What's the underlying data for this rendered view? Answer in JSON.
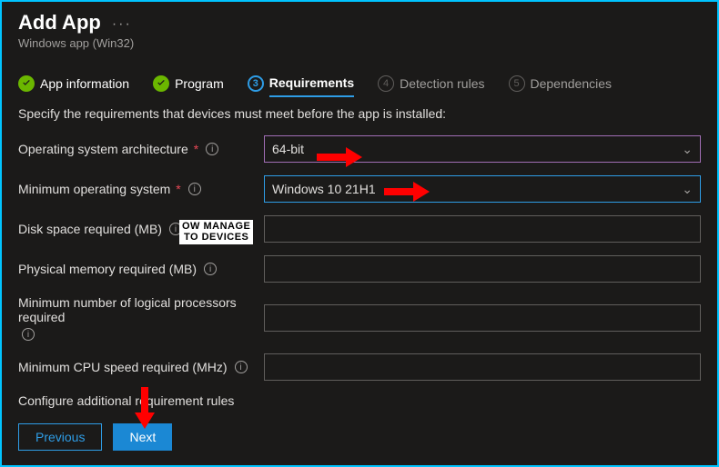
{
  "header": {
    "title": "Add App",
    "ellipsis": "···",
    "subtitle": "Windows app (Win32)"
  },
  "tabs": {
    "t1": "App information",
    "t2": "Program",
    "t3": "Requirements",
    "t4": "Detection rules",
    "t5": "Dependencies",
    "n3": "3",
    "n4": "4",
    "n5": "5"
  },
  "instruction": "Specify the requirements that devices must meet before the app is installed:",
  "fields": {
    "arch": {
      "label": "Operating system architecture",
      "required": "*",
      "value": "64-bit"
    },
    "minos": {
      "label": "Minimum operating system",
      "required": "*",
      "value": "Windows 10 21H1"
    },
    "disk": {
      "label": "Disk space required (MB)",
      "value": ""
    },
    "mem": {
      "label": "Physical memory required (MB)",
      "value": ""
    },
    "cpu_count": {
      "label": "Minimum number of logical processors required",
      "value": ""
    },
    "cpu_speed": {
      "label": "Minimum CPU speed required (MHz)",
      "value": ""
    }
  },
  "section": {
    "additional": "Configure additional requirement rules"
  },
  "footer": {
    "prev": "Previous",
    "next": "Next"
  },
  "info_glyph": "i",
  "chev_glyph": "⌄",
  "watermark": {
    "l1": "OW MANAGE",
    "l2": "TO DEVICES"
  }
}
